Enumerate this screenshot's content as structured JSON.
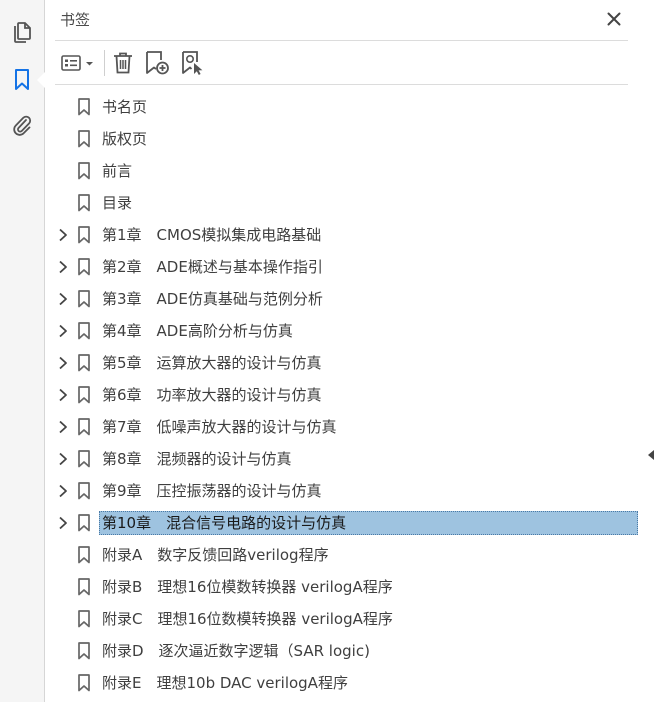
{
  "panel": {
    "title": "书签"
  },
  "rail": {
    "items": [
      {
        "icon": "page-thumbnails-icon"
      },
      {
        "icon": "bookmark-icon",
        "active": true
      },
      {
        "icon": "paperclip-icon"
      }
    ],
    "accent": "#1473e6"
  },
  "toolbar": {
    "buttons": [
      {
        "icon": "options-menu-icon"
      },
      {
        "icon": "trash-icon"
      },
      {
        "icon": "new-bookmark-icon"
      },
      {
        "icon": "bookmark-from-selection-icon"
      }
    ]
  },
  "bookmarks": [
    {
      "label": "书名页",
      "expandable": false
    },
    {
      "label": "版权页",
      "expandable": false
    },
    {
      "label": "前言",
      "expandable": false
    },
    {
      "label": "目录",
      "expandable": false
    },
    {
      "label": "第1章　CMOS模拟集成电路基础",
      "expandable": true
    },
    {
      "label": "第2章　ADE概述与基本操作指引",
      "expandable": true
    },
    {
      "label": "第3章　ADE仿真基础与范例分析",
      "expandable": true
    },
    {
      "label": "第4章　ADE高阶分析与仿真",
      "expandable": true
    },
    {
      "label": "第5章　运算放大器的设计与仿真",
      "expandable": true
    },
    {
      "label": "第6章　功率放大器的设计与仿真",
      "expandable": true
    },
    {
      "label": "第7章　低噪声放大器的设计与仿真",
      "expandable": true
    },
    {
      "label": "第8章　混频器的设计与仿真",
      "expandable": true
    },
    {
      "label": "第9章　压控振荡器的设计与仿真",
      "expandable": true
    },
    {
      "label": "第10章　混合信号电路的设计与仿真",
      "expandable": true,
      "selected": true
    },
    {
      "label": "附录A　数字反馈回路verilog程序",
      "expandable": false
    },
    {
      "label": "附录B　理想16位模数转换器 verilogA程序",
      "expandable": false
    },
    {
      "label": "附录C　理想16位数模转换器 verilogA程序",
      "expandable": false
    },
    {
      "label": "附录D　逐次逼近数字逻辑（SAR logic)",
      "expandable": false
    },
    {
      "label": "附录E　理想10b DAC verilogA程序",
      "expandable": false
    }
  ],
  "colors": {
    "selection": "#9ec3e0",
    "icon": "#555555"
  }
}
